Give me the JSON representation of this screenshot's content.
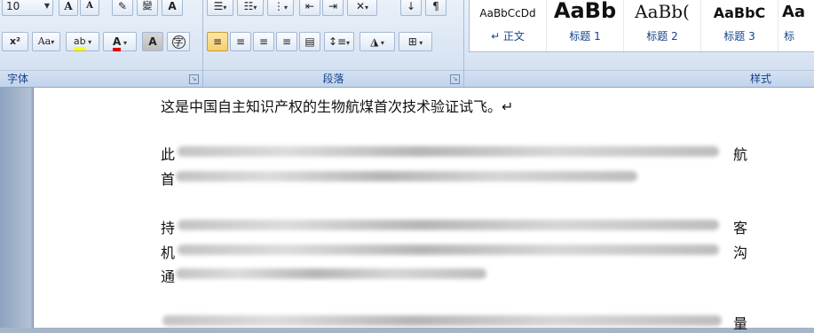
{
  "ribbon": {
    "font_group": {
      "label": "字体",
      "font_size": "10",
      "grow_label": "A",
      "shrink_label": "A",
      "phonetic_label": "變",
      "border_char_label": "A",
      "superscript_label": "x²",
      "change_case_label": "Aa",
      "highlight_label": "ab",
      "font_color_label": "A",
      "char_shading_label": "A",
      "enclose_label": "字"
    },
    "paragraph_group": {
      "label": "段落"
    },
    "styles_group": {
      "label": "样式",
      "items": [
        {
          "sample": "AaBbCcDd",
          "name": "↵ 正文"
        },
        {
          "sample": "AaBb",
          "name": "标题 1"
        },
        {
          "sample": "AaBb(",
          "name": "标题 2"
        },
        {
          "sample": "AaBbC",
          "name": "标题 3"
        },
        {
          "sample": "Aa",
          "name": "标"
        }
      ]
    }
  },
  "document": {
    "top_line": "这是中国自主知识产权的生物航煤首次技术验证试飞。↵",
    "para1_visible_start": "此",
    "para1_visible_end": "航",
    "para2_visible_start": "首",
    "para3_visible_start": "持",
    "para3_visible_end": "客",
    "para3_line2_start": "机",
    "para3_line2_end": "沟",
    "para3_line3_start": "通",
    "para4_visible_end": "量"
  },
  "colors": {
    "ribbon_label": "#15428b",
    "highlight_yellow": "#ffff00",
    "font_red": "#e00000"
  }
}
